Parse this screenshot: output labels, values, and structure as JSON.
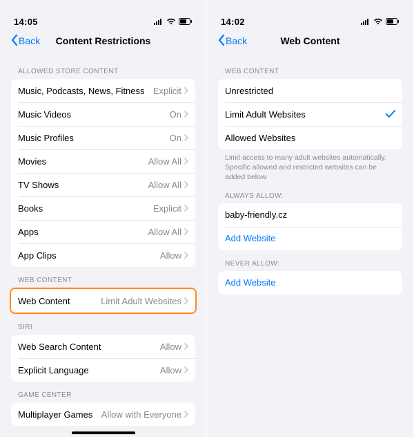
{
  "left": {
    "status_time": "14:05",
    "back_label": "Back",
    "title": "Content Restrictions",
    "sections": {
      "allowed_store": {
        "header": "ALLOWED STORE CONTENT",
        "rows": [
          {
            "label": "Music, Podcasts, News, Fitness",
            "value": "Explicit"
          },
          {
            "label": "Music Videos",
            "value": "On"
          },
          {
            "label": "Music Profiles",
            "value": "On"
          },
          {
            "label": "Movies",
            "value": "Allow All"
          },
          {
            "label": "TV Shows",
            "value": "Allow All"
          },
          {
            "label": "Books",
            "value": "Explicit"
          },
          {
            "label": "Apps",
            "value": "Allow All"
          },
          {
            "label": "App Clips",
            "value": "Allow"
          }
        ]
      },
      "web_content": {
        "header": "WEB CONTENT",
        "rows": [
          {
            "label": "Web Content",
            "value": "Limit Adult Websites"
          }
        ]
      },
      "siri": {
        "header": "SIRI",
        "rows": [
          {
            "label": "Web Search Content",
            "value": "Allow"
          },
          {
            "label": "Explicit Language",
            "value": "Allow"
          }
        ]
      },
      "game_center": {
        "header": "GAME CENTER",
        "rows": [
          {
            "label": "Multiplayer Games",
            "value": "Allow with Everyone"
          }
        ]
      }
    }
  },
  "right": {
    "status_time": "14:02",
    "back_label": "Back",
    "title": "Web Content",
    "sections": {
      "web_content": {
        "header": "WEB CONTENT",
        "options": [
          {
            "label": "Unrestricted",
            "checked": false
          },
          {
            "label": "Limit Adult Websites",
            "checked": true
          },
          {
            "label": "Allowed Websites",
            "checked": false
          }
        ],
        "footer": "Limit access to many adult websites automatically. Specific allowed and restricted websites can be added below."
      },
      "always_allow": {
        "header": "ALWAYS ALLOW:",
        "rows": [
          {
            "label": "baby-friendly.cz"
          }
        ],
        "add_label": "Add Website"
      },
      "never_allow": {
        "header": "NEVER ALLOW:",
        "add_label": "Add Website"
      }
    }
  },
  "icons": {
    "back_chevron": "chevron-left-icon",
    "row_chevron": "chevron-right-icon",
    "check": "checkmark-icon",
    "signal": "cellular-signal-icon",
    "wifi": "wifi-icon",
    "battery": "battery-icon"
  },
  "colors": {
    "tint": "#007aff",
    "highlight": "#ff8c1a",
    "secondary": "#8a8a8e",
    "bg": "#f2f2f7"
  }
}
